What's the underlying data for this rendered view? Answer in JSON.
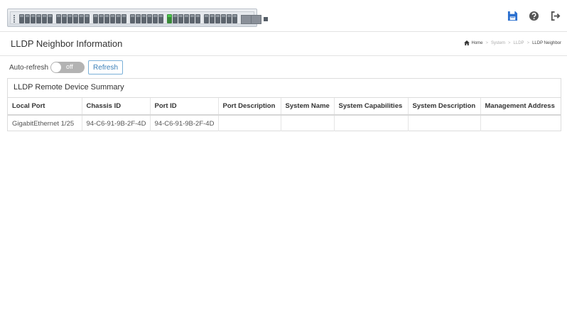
{
  "header": {
    "icons": {
      "save": "save-icon",
      "help": "help-icon",
      "logout": "logout-icon"
    },
    "accent_color": "#2a6fcf"
  },
  "page": {
    "title": "LLDP Neighbor Information",
    "breadcrumb": [
      "Home",
      "System",
      "LLDP",
      "LLDP Neighbor"
    ]
  },
  "controls": {
    "auto_refresh_label": "Auto-refresh",
    "toggle_state": "off",
    "refresh_label": "Refresh"
  },
  "summary": {
    "title": "LLDP Remote Device Summary",
    "columns": [
      "Local Port",
      "Chassis ID",
      "Port ID",
      "Port Description",
      "System Name",
      "System Capabilities",
      "System Description",
      "Management Address"
    ],
    "rows": [
      [
        "GigabitEthernet 1/25",
        "94-C6-91-9B-2F-4D",
        "94-C6-91-9B-2F-4D",
        "",
        "",
        "",
        "",
        ""
      ]
    ]
  }
}
